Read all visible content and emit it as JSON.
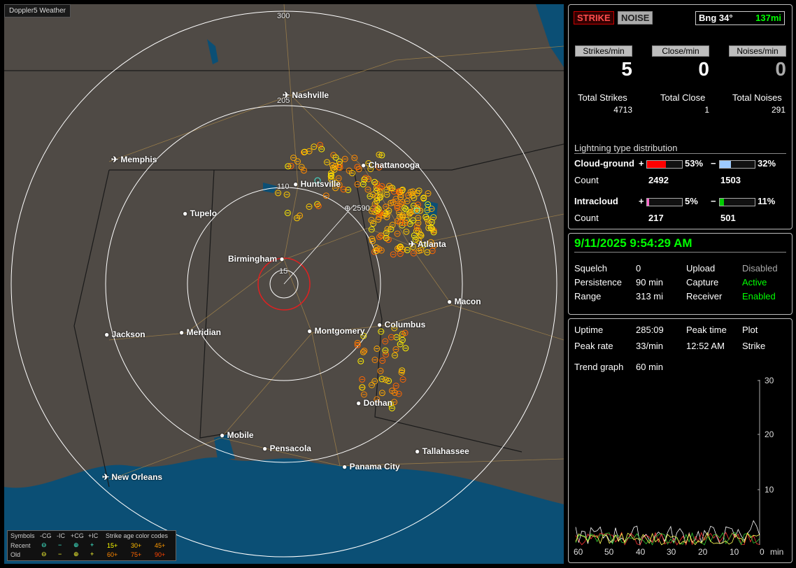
{
  "app": {
    "brand": "Doppler5 Weather"
  },
  "map": {
    "range_labels": [
      "300",
      "205",
      "110",
      "15"
    ],
    "cities": [
      {
        "name": "Nashville",
        "airport": true
      },
      {
        "name": "Memphis",
        "airport": true
      },
      {
        "name": "Chattanooga",
        "airport": false
      },
      {
        "name": "Huntsville",
        "airport": false
      },
      {
        "name": "Tupelo",
        "airport": false
      },
      {
        "name": "Birmingham",
        "airport": false
      },
      {
        "name": "Atlanta",
        "airport": true
      },
      {
        "name": "Macon",
        "airport": false
      },
      {
        "name": "Columbus",
        "airport": false
      },
      {
        "name": "Montgomery",
        "airport": false
      },
      {
        "name": "Meridian",
        "airport": false
      },
      {
        "name": "Jackson",
        "airport": false
      },
      {
        "name": "Dothan",
        "airport": false
      },
      {
        "name": "Mobile",
        "airport": false
      },
      {
        "name": "Pensacola",
        "airport": false
      },
      {
        "name": "Tallahassee",
        "airport": false
      },
      {
        "name": "Panama City",
        "airport": false
      },
      {
        "name": "New Orleans",
        "airport": true
      }
    ],
    "cursor_label": "2590",
    "cursor_extra": "2"
  },
  "legend": {
    "symbols_title": "Symbols",
    "cols": [
      "-CG",
      "-IC",
      "+CG",
      "+IC"
    ],
    "recent": "Recent",
    "old": "Old",
    "age_title": "Strike age color codes",
    "recent_ages": [
      "15+",
      "30+",
      "45+"
    ],
    "old_ages": [
      "60+",
      "75+",
      "90+"
    ]
  },
  "status": {
    "strike_btn": "STRIKE",
    "noise_btn": "NOISE",
    "bearing": "Bng 34°",
    "distance": "137mi"
  },
  "rates": {
    "strikes_hdr": "Strikes/min",
    "strikes": "5",
    "close_hdr": "Close/min",
    "close": "0",
    "noises_hdr": "Noises/min",
    "noises": "0",
    "total_strikes_lbl": "Total Strikes",
    "total_strikes": "4713",
    "total_close_lbl": "Total Close",
    "total_close": "1",
    "total_noises_lbl": "Total Noises",
    "total_noises": "291"
  },
  "distribution": {
    "title": "Lightning type distribution",
    "cg_label": "Cloud-ground",
    "ic_label": "Intracloud",
    "count_label": "Count",
    "cg_pos_pct": "53%",
    "cg_neg_pct": "32%",
    "cg_pos_count": "2492",
    "cg_neg_count": "1503",
    "ic_pos_pct": "5%",
    "ic_neg_pct": "11%",
    "ic_pos_count": "217",
    "ic_neg_count": "501",
    "cg_pos_frac": 0.53,
    "cg_neg_frac": 0.32,
    "ic_pos_frac": 0.05,
    "ic_neg_frac": 0.11,
    "plus": "+",
    "minus": "−"
  },
  "clock": {
    "datetime": "9/11/2025 9:54:29 AM"
  },
  "settings": {
    "squelch_lbl": "Squelch",
    "squelch": "0",
    "persistence_lbl": "Persistence",
    "persistence": "90 min",
    "range_lbl": "Range",
    "range": "313 mi",
    "upload_lbl": "Upload",
    "upload": "Disabled",
    "capture_lbl": "Capture",
    "capture": "Active",
    "receiver_lbl": "Receiver",
    "receiver": "Enabled"
  },
  "stats": {
    "uptime_lbl": "Uptime",
    "uptime": "285:09",
    "peak_rate_lbl": "Peak rate",
    "peak_rate": "33/min",
    "peak_time_lbl": "Peak time",
    "peak_time": "12:52 AM",
    "plot_lbl": "Plot",
    "plot": "Strike",
    "trend_lbl": "Trend graph",
    "trend": "60 min"
  },
  "trend": {
    "y_ticks": [
      "30",
      "20",
      "10"
    ],
    "x_ticks": [
      "60",
      "50",
      "40",
      "30",
      "20",
      "10",
      "0"
    ],
    "x_unit": "min"
  },
  "colors": {
    "strike_red": "#c00000",
    "green_text": "#00ff00",
    "cg_pos": "#ff0000",
    "cg_neg": "#9ecbff",
    "ic_pos": "#ff66cc",
    "ic_neg": "#00cc00"
  }
}
